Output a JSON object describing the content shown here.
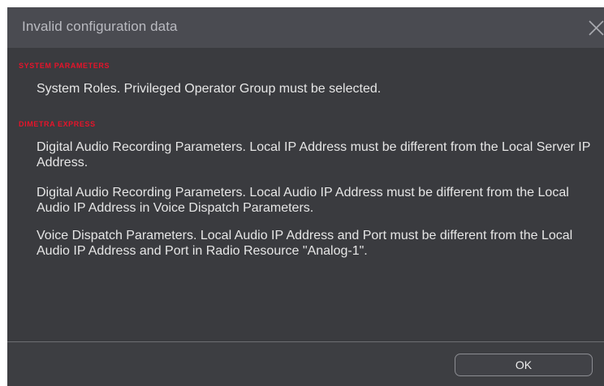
{
  "dialog": {
    "title": "Invalid configuration data",
    "close_icon": "close-icon",
    "sections": [
      {
        "title": "SYSTEM PARAMETERS",
        "messages": [
          "System Roles. Privileged Operator Group must be selected."
        ]
      },
      {
        "title": "DIMETRA EXPRESS",
        "messages": [
          "Digital Audio Recording Parameters. Local IP Address must be different from the Local Server IP Address.",
          "Digital Audio Recording Parameters. Local Audio IP Address must be different from the Local Audio IP Address in Voice Dispatch Parameters.",
          "Voice Dispatch Parameters. Local Audio IP Address and Port must be different from the Local Audio IP Address and Port in Radio Resource \"Analog-1\"."
        ]
      }
    ],
    "ok_label": "OK"
  },
  "colors": {
    "section_title": "#e8132a",
    "dialog_bg": "#3a3b3f",
    "titlebar_bg": "#4a4b51"
  }
}
